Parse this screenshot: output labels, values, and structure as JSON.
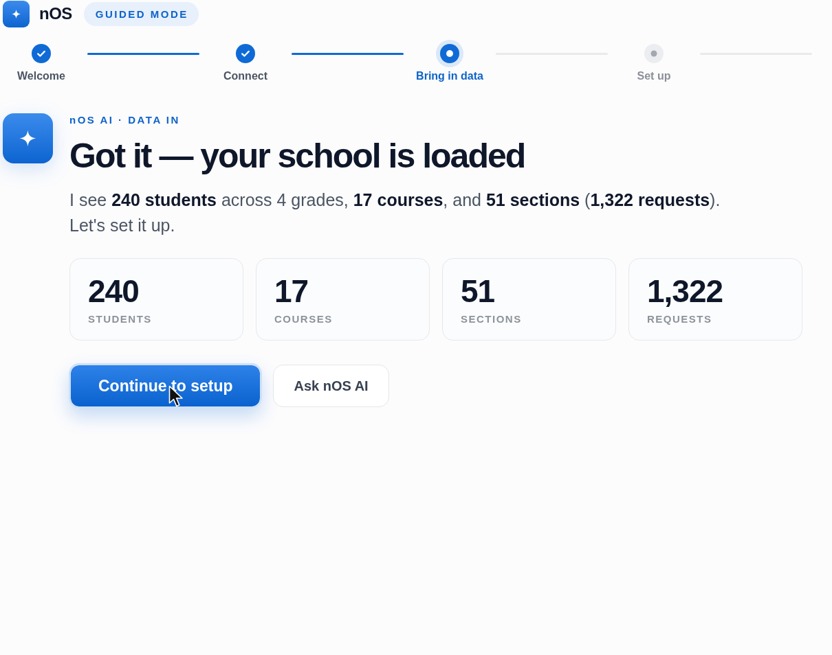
{
  "header": {
    "app_name": "nOS",
    "mode_badge": "GUIDED MODE"
  },
  "stepper": {
    "steps": [
      {
        "label": "Welcome",
        "completed": true,
        "selected": false
      },
      {
        "label": "Connect",
        "completed": true,
        "selected": false
      },
      {
        "label": "Bring in data",
        "completed": false,
        "selected": true
      },
      {
        "label": "Set up",
        "completed": false,
        "selected": false
      }
    ]
  },
  "assistant": {
    "eyebrow": "nOS AI · DATA IN",
    "heading": "Got it — your school is loaded",
    "summary_lines": [
      "I see **240 students** across 4 grades, **17 courses**, and **51 sections** (**1,322 requests**).",
      "Let's set it up."
    ]
  },
  "stats": [
    {
      "value": "240",
      "label": "STUDENTS"
    },
    {
      "value": "17",
      "label": "COURSES"
    },
    {
      "value": "51",
      "label": "SECTIONS"
    },
    {
      "value": "1,322",
      "label": "REQUESTS"
    }
  ],
  "actions": [
    {
      "label": "Continue to setup",
      "kind": "primary"
    },
    {
      "label": "Ask nOS AI",
      "kind": "secondary"
    }
  ]
}
